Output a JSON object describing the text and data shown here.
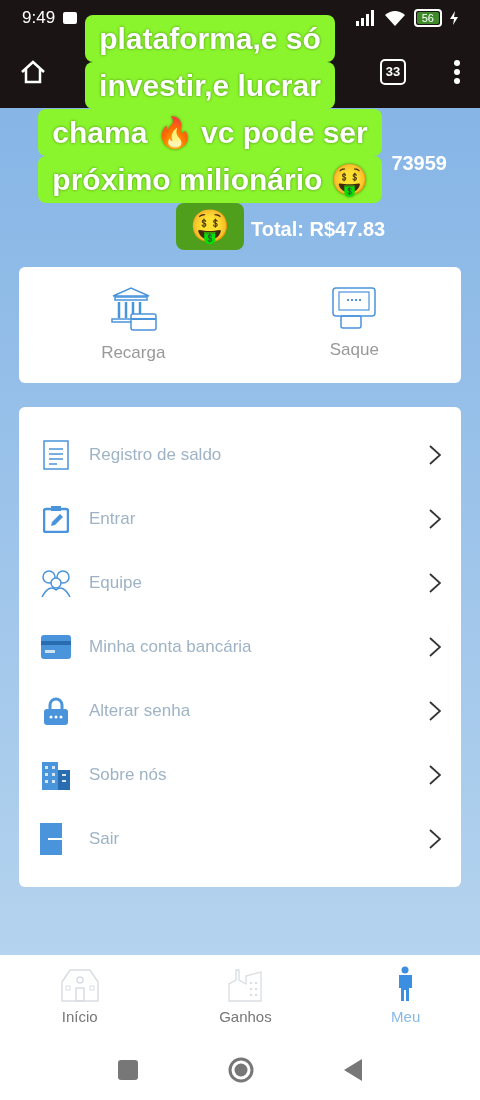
{
  "status_bar": {
    "time": "9:49",
    "battery": "56"
  },
  "browser_bar": {
    "tab_count": "33"
  },
  "account": {
    "id_fragment": "73959",
    "total": "Total: R$47.83"
  },
  "actions": [
    {
      "kind": "bank",
      "label": "Recarga"
    },
    {
      "kind": "atm",
      "label": "Saque"
    }
  ],
  "menu": [
    {
      "kind": "record",
      "label": "Registro de saldo"
    },
    {
      "kind": "edit",
      "label": "Entrar"
    },
    {
      "kind": "team",
      "label": "Equipe"
    },
    {
      "kind": "card",
      "label": "Minha conta bancária"
    },
    {
      "kind": "lock",
      "label": "Alterar senha"
    },
    {
      "kind": "building",
      "label": "Sobre nós"
    },
    {
      "kind": "exit",
      "label": "Sair"
    }
  ],
  "bottom_nav": [
    {
      "kind": "home",
      "label": "Início",
      "selected": false
    },
    {
      "kind": "factory",
      "label": "Ganhos",
      "selected": false
    },
    {
      "kind": "person",
      "label": "Meu",
      "selected": true
    }
  ],
  "caption": {
    "lines": [
      "plataforma,e só",
      "investir,e lucrar",
      "chama 🔥 vc pode ser",
      "próximo milionário 🤑",
      "🤑"
    ]
  }
}
